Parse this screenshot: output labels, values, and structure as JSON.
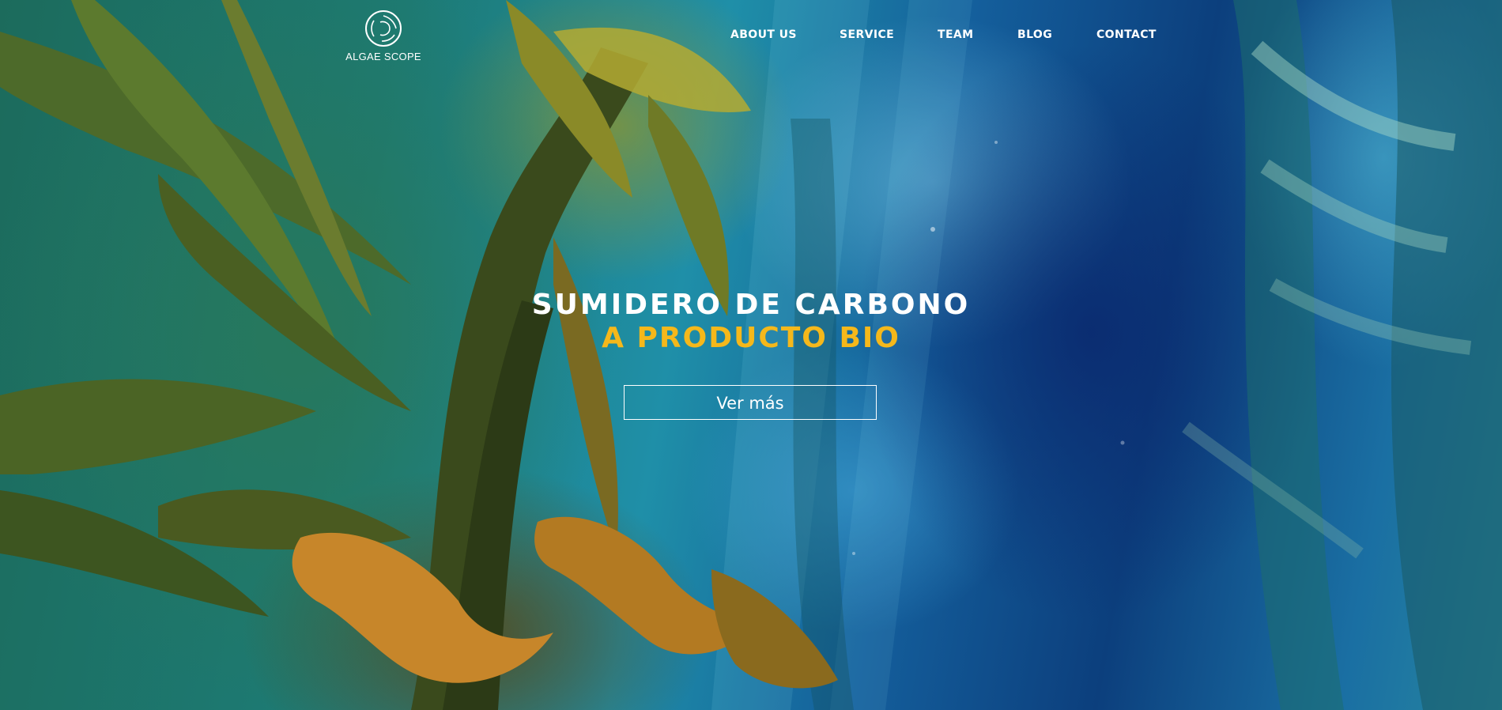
{
  "brand": {
    "name": "ALGAE SCOPE",
    "logo_icon": "swirl-logo-icon"
  },
  "nav": {
    "items": [
      {
        "label": "ABOUT US"
      },
      {
        "label": "SERVICE"
      },
      {
        "label": "TEAM"
      },
      {
        "label": "BLOG"
      },
      {
        "label": "CONTACT"
      }
    ]
  },
  "hero": {
    "title_line1": "SUMIDERO DE CARBONO",
    "title_line2": "A PRODUCTO BIO",
    "cta_label": "Ver más",
    "background": "underwater kelp forest photo"
  },
  "colors": {
    "accent": "#f5b81b",
    "text": "#ffffff"
  }
}
